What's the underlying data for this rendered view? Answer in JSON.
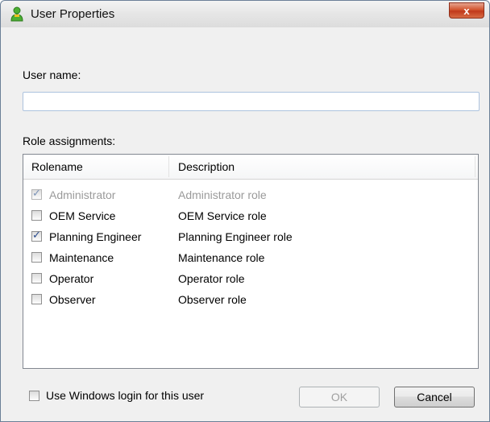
{
  "window": {
    "title": "User Properties",
    "close_label": "x",
    "icon": "user-icon"
  },
  "user_name": {
    "label": "User name:",
    "value": "",
    "placeholder": ""
  },
  "roles": {
    "label": "Role assignments:",
    "columns": [
      "Rolename",
      "Description"
    ],
    "rows": [
      {
        "name": "Administrator",
        "description": "Administrator role",
        "checked": true,
        "disabled": true
      },
      {
        "name": "OEM Service",
        "description": "OEM Service role",
        "checked": false,
        "disabled": false
      },
      {
        "name": "Planning Engineer",
        "description": "Planning Engineer role",
        "checked": true,
        "disabled": false
      },
      {
        "name": "Maintenance",
        "description": "Maintenance role",
        "checked": false,
        "disabled": false
      },
      {
        "name": "Operator",
        "description": "Operator role",
        "checked": false,
        "disabled": false
      },
      {
        "name": "Observer",
        "description": "Observer role",
        "checked": false,
        "disabled": false
      }
    ]
  },
  "footer": {
    "windows_login_label": "Use Windows login for this user",
    "windows_login_checked": false,
    "ok_label": "OK",
    "cancel_label": "Cancel"
  },
  "colors": {
    "close_button": "#c7422a",
    "checkbox_mark": "#2a4b8d",
    "disabled_text": "#9a9a9a"
  }
}
